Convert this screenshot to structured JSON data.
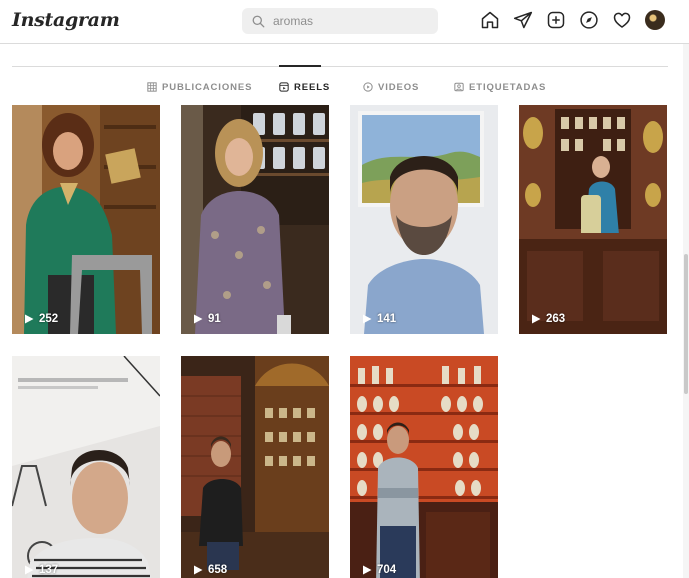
{
  "brand": "Instagram",
  "search": {
    "value": "aromas"
  },
  "nav": {
    "icons": [
      "home-icon",
      "direct-send-icon",
      "new-post-icon",
      "explore-compass-icon",
      "activity-heart-icon",
      "profile-avatar"
    ]
  },
  "tabs": [
    {
      "label": "PUBLICACIONES",
      "icon": "grid-icon",
      "active": false
    },
    {
      "label": "REELS",
      "icon": "reels-icon",
      "active": true
    },
    {
      "label": "VIDEOS",
      "icon": "video-icon",
      "active": false
    },
    {
      "label": "ETIQUETADAS",
      "icon": "tagged-icon",
      "active": false
    }
  ],
  "reels": [
    {
      "views": "252"
    },
    {
      "views": "91"
    },
    {
      "views": "141"
    },
    {
      "views": "263"
    },
    {
      "views": "137"
    },
    {
      "views": "658"
    },
    {
      "views": "704"
    }
  ],
  "colors": {
    "accent_text": "#262626",
    "muted_text": "#8e8e8e",
    "divider": "#dbdbdb"
  }
}
